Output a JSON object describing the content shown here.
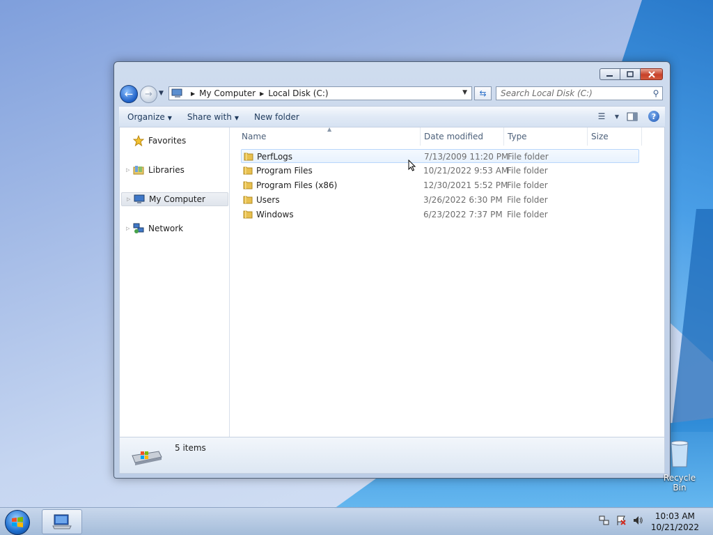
{
  "window": {
    "address": {
      "crumbs": [
        "My Computer",
        "Local Disk (C:)"
      ]
    },
    "search": {
      "placeholder": "Search Local Disk (C:)"
    },
    "toolbar": {
      "organize": "Organize",
      "share_with": "Share with",
      "new_folder": "New folder"
    },
    "nav": {
      "items": [
        {
          "label": "Favorites",
          "icon": "star-icon"
        },
        {
          "label": "Libraries",
          "icon": "libraries-icon"
        },
        {
          "label": "My Computer",
          "icon": "computer-icon",
          "selected": true
        },
        {
          "label": "Network",
          "icon": "network-icon"
        }
      ]
    },
    "columns": {
      "name": "Name",
      "date": "Date modified",
      "type": "Type",
      "size": "Size"
    },
    "files": [
      {
        "name": "PerfLogs",
        "date": "7/13/2009 11:20 PM",
        "type": "File folder"
      },
      {
        "name": "Program Files",
        "date": "10/21/2022 9:53 AM",
        "type": "File folder"
      },
      {
        "name": "Program Files (x86)",
        "date": "12/30/2021 5:52 PM",
        "type": "File folder"
      },
      {
        "name": "Users",
        "date": "3/26/2022 6:30 PM",
        "type": "File folder"
      },
      {
        "name": "Windows",
        "date": "6/23/2022 7:37 PM",
        "type": "File folder"
      }
    ],
    "status": {
      "item_count": "5 items"
    }
  },
  "desktop": {
    "recycle_bin": "Recycle Bin"
  },
  "taskbar": {
    "time": "10:03 AM",
    "date": "10/21/2022"
  },
  "colors": {
    "accent": "#1d5fc6",
    "selection_border": "#b8d6fb",
    "close_button": "#c7412a"
  }
}
